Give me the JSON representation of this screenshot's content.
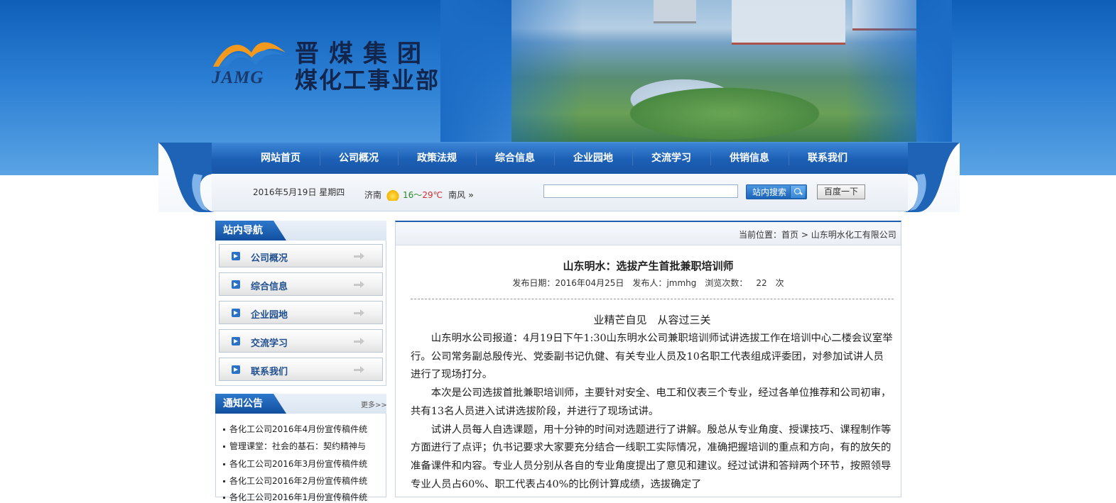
{
  "header": {
    "logo_abbr": "JAMG",
    "logo_line1": "晋煤集团",
    "logo_line2": "煤化工事业部"
  },
  "nav": {
    "items": [
      "网站首页",
      "公司概况",
      "政策法规",
      "综合信息",
      "企业园地",
      "交流学习",
      "供销信息",
      "联系我们"
    ]
  },
  "topbar": {
    "date": "2016年5月19日  星期四",
    "weather": {
      "city": "济南",
      "icon": "sun-icon",
      "temp_low": "16",
      "temp_sep": "～",
      "temp_high": "29℃",
      "wind": "南风",
      "more": "»"
    },
    "search": {
      "value": "",
      "placeholder": ""
    },
    "site_search_label": "站内搜索",
    "baidu_label": "百度一下"
  },
  "sidebar": {
    "nav_title": "站内导航",
    "items": [
      "公司概况",
      "综合信息",
      "企业园地",
      "交流学习",
      "联系我们"
    ],
    "notice_title": "通知公告",
    "more": "更多>>",
    "notices": [
      "各化工公司2016年4月份宣传稿件统",
      "管理课堂：社会的基石：契约精神与",
      "各化工公司2016年3月份宣传稿件统",
      "各化工公司2016年2月份宣传稿件统",
      "各化工公司2016年1月份宣传稿件统"
    ]
  },
  "breadcrumb": {
    "prefix": "当前位置：",
    "home": "首页",
    "sep": " > ",
    "current": "山东明水化工有限公司"
  },
  "article": {
    "title": "山东明水：选拔产生首批兼职培训师",
    "date_label": "发布日期：",
    "date": "2016年04月25日",
    "author_label": "发布人：",
    "author": "jmmhg",
    "views_label": "浏览次数：",
    "views": "22",
    "views_unit": "次",
    "subtitle": "业精芒自见　从容过三关",
    "paragraphs": [
      "山东明水公司报道：4月19日下午1:30山东明水公司兼职培训师试讲选拔工作在培训中心二楼会议室举行。公司常务副总殷传光、党委副书记仇健、有关专业人员及10名职工代表组成评委团，对参加试讲人员进行了现场打分。",
      "本次是公司选拔首批兼职培训师，主要针对安全、电工和仪表三个专业，经过各单位推荐和公司初审，共有13名人员进入试讲选拔阶段，并进行了现场试讲。",
      "试讲人员每人自选课题，用十分钟的时间对选题进行了讲解。殷总从专业角度、授课技巧、课程制作等方面进行了点评；仇书记要求大家要充分结合一线职工实际情况，准确把握培训的重点和方向，有的放矢的准备课件和内容。专业人员分别从各自的专业角度提出了意见和建议。经过试讲和答辩两个环节，按照领导专业人员占60%、职工代表占40%的比例计算成绩，选拔确定了"
    ]
  },
  "colors": {
    "nav_blue": "#1b5fb4",
    "link_blue": "#1f4f8f",
    "temp_low": "#2a8a2a",
    "temp_high": "#d23030"
  }
}
